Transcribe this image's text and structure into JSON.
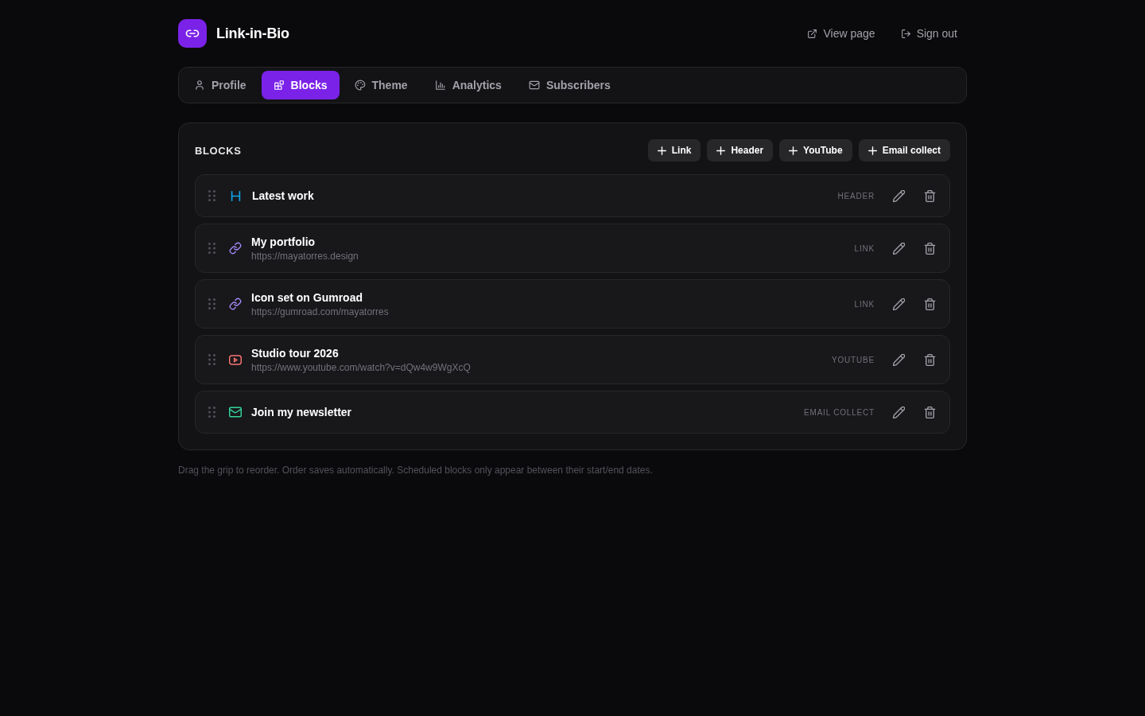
{
  "header": {
    "title": "Link-in-Bio",
    "actions": [
      {
        "kind": "external",
        "label": "View page"
      },
      {
        "kind": "signout",
        "label": "Sign out"
      }
    ]
  },
  "tabs": [
    {
      "kind": "person",
      "label": "Profile",
      "selected": false
    },
    {
      "kind": "blocks",
      "label": "Blocks",
      "selected": true
    },
    {
      "kind": "palette",
      "label": "Theme",
      "selected": false
    },
    {
      "kind": "chart",
      "label": "Analytics",
      "selected": false
    },
    {
      "kind": "mail",
      "label": "Subscribers",
      "selected": false
    }
  ],
  "blocks_panel": {
    "title": "BLOCKS",
    "add_buttons": [
      "Link",
      "Header",
      "YouTube",
      "Email collect"
    ],
    "blocks": [
      {
        "kind": "header",
        "title": "Latest work",
        "type_label": "HEADER"
      },
      {
        "kind": "link",
        "title": "My portfolio",
        "url": "https://mayatorres.design",
        "type_label": "LINK"
      },
      {
        "kind": "link",
        "title": "Icon set on Gumroad",
        "url": "https://gumroad.com/mayatorres",
        "type_label": "LINK"
      },
      {
        "kind": "youtube",
        "title": "Studio tour 2026",
        "url": "https://www.youtube.com/watch?v=dQw4w9WgXcQ",
        "type_label": "YOUTUBE"
      },
      {
        "kind": "email",
        "title": "Join my newsletter",
        "type_label": "EMAIL COLLECT"
      }
    ]
  },
  "footer_note": "Drag the grip to reorder. Order saves automatically. Scheduled blocks only appear between their start/end dates."
}
